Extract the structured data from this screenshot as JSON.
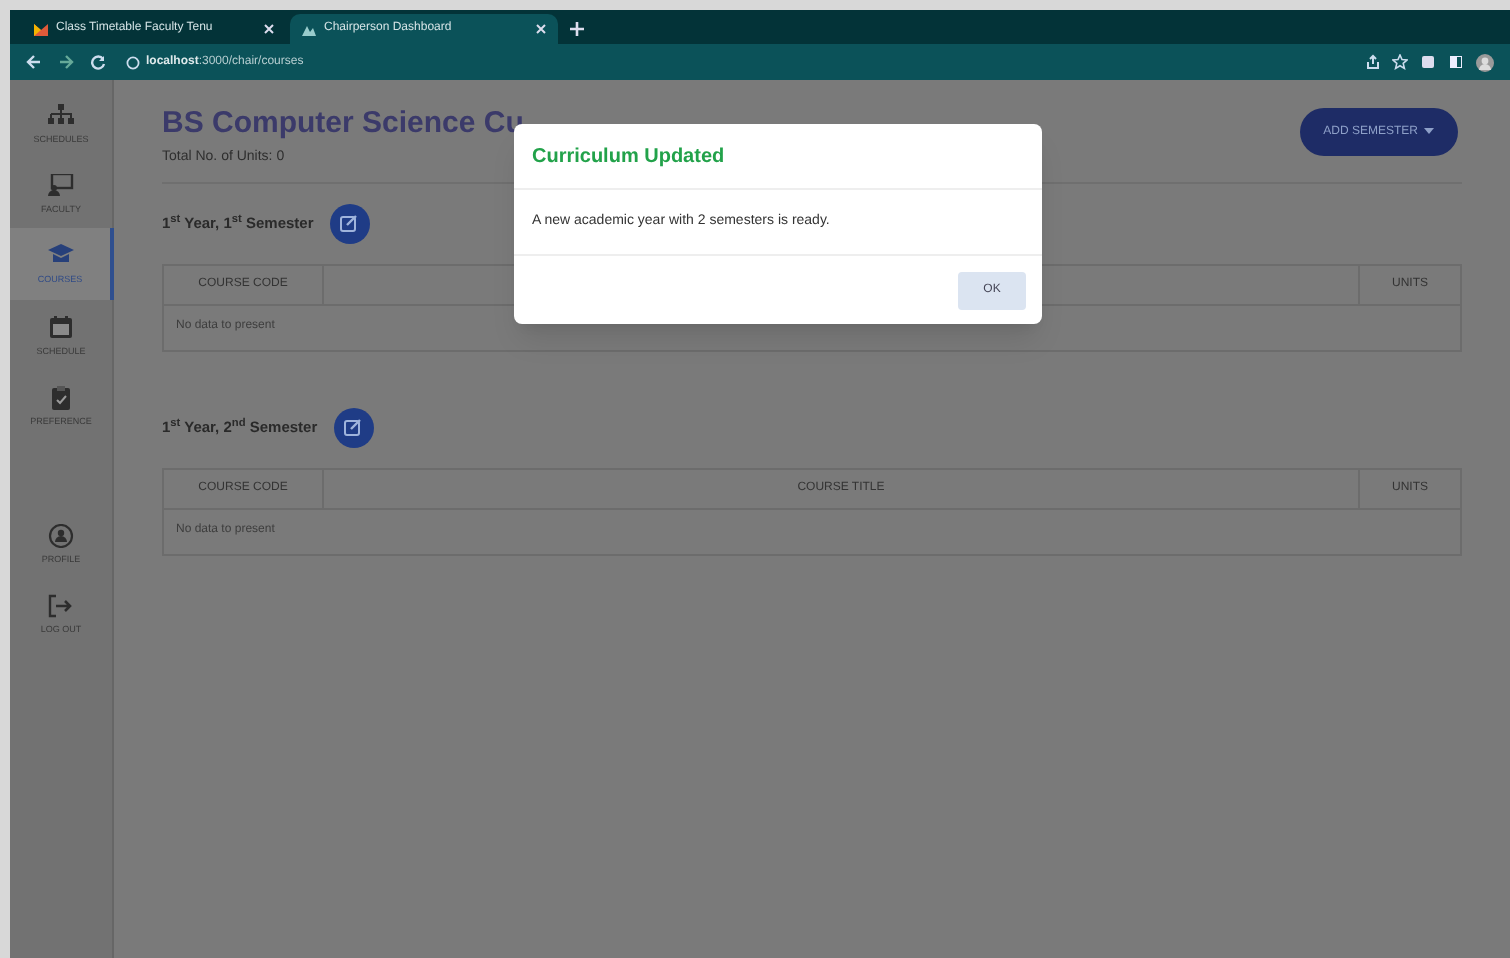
{
  "browser": {
    "tabs": [
      {
        "title": "Class Timetable Faculty Tenu",
        "selected": false
      },
      {
        "title": "Chairperson Dashboard",
        "selected": true
      }
    ],
    "url_host": "localhost",
    "url_path": ":3000/chair/courses"
  },
  "sidebar": {
    "items": [
      {
        "label": "SCHEDULES",
        "kind": "hierarchy",
        "selected": false
      },
      {
        "label": "FACULTY",
        "kind": "teacher",
        "selected": false
      },
      {
        "label": "COURSES",
        "kind": "cap",
        "selected": true
      },
      {
        "label": "SCHEDULE",
        "kind": "calendar",
        "selected": false
      },
      {
        "label": "PREFERENCE",
        "kind": "clipboard",
        "selected": false
      },
      {
        "label": "PROFILE",
        "kind": "user",
        "selected": false
      },
      {
        "label": "LOG OUT",
        "kind": "logout",
        "selected": false
      }
    ]
  },
  "page": {
    "title": "BS Computer Science Cu",
    "total_units": "Total No. of Units: 0",
    "add_button": "ADD SEMESTER"
  },
  "semesters": [
    {
      "title": "1$^{st}$ Year, 1$^{st}$ Semester",
      "columns": [
        "COURSE CODE",
        "UNITS"
      ],
      "empty_text": "No data to present"
    },
    {
      "title": "1$^{st}$ Year, 2$^{nd}$ Semester",
      "columns": [
        "COURSE CODE",
        "COURSE TITLE",
        "UNITS"
      ],
      "empty_text": "No data to present"
    }
  ],
  "dialog": {
    "title": "Curriculum Updated",
    "message": "A new academic year with 2 semesters is ready.",
    "button": "OK"
  }
}
